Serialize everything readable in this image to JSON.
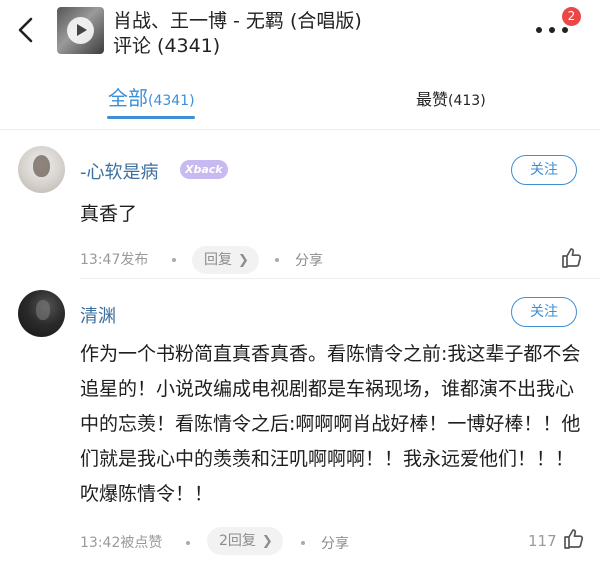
{
  "header": {
    "song_title": "肖战、王一博 - 无羁 (合唱版)",
    "subtitle": "评论 (4341)",
    "notification_count": "2"
  },
  "tabs": [
    {
      "label": "全部",
      "count": "(4341)",
      "active": true
    },
    {
      "label": "最赞",
      "count": "(413)",
      "active": false
    }
  ],
  "comments": [
    {
      "username": "-心软是病",
      "badge": "Xback",
      "follow_label": "关注",
      "text": "真香了",
      "time": "13:47发布",
      "reply_label": "回复",
      "share_label": "分享",
      "likes": ""
    },
    {
      "username": "清渊",
      "follow_label": "关注",
      "text": "作为一个书粉简直真香真香。看陈情令之前:我这辈子都不会追星的！小说改编成电视剧都是车祸现场，谁都演不出我心中的忘羡！看陈情令之后:啊啊啊肖战好棒！一博好棒！！他们就是我心中的羡羡和汪叽啊啊啊！！我永远爱他们！！！吹爆陈情令！！",
      "time": "13:42被点赞",
      "reply_label": "2回复",
      "share_label": "分享",
      "likes": "117"
    }
  ],
  "colors": {
    "accent": "#3d8fd6",
    "username": "#3d6fa0",
    "badge_red": "#ea4747",
    "meta_gray": "#9a9a9a"
  },
  "icons": {
    "back": "chevron-left-icon",
    "more": "more-dots-icon",
    "play": "play-icon",
    "like": "thumbs-up-icon",
    "reply_arrow": "chevron-right-icon"
  }
}
